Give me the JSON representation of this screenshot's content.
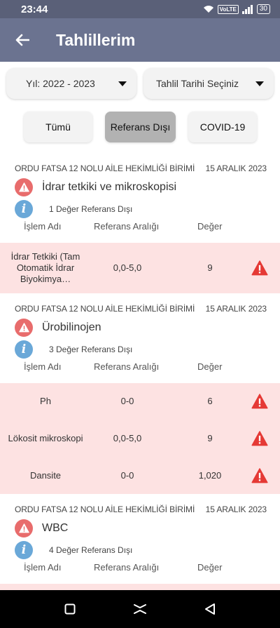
{
  "status_bar": {
    "time": "23:44",
    "network": "VoLTE",
    "battery": "30"
  },
  "app_bar": {
    "title": "Tahlillerim"
  },
  "filters": {
    "year": "Yıl: 2022 - 2023",
    "date": "Tahlil Tarihi Seçiniz"
  },
  "tabs": [
    {
      "label": "Tümü",
      "active": false
    },
    {
      "label": "Referans Dışı",
      "active": true
    },
    {
      "label": "COVID-19",
      "active": false
    }
  ],
  "column_headers": {
    "name": "İşlem Adı",
    "range": "Referans Aralığı",
    "value": "Değer"
  },
  "records": [
    {
      "institution": "ORDU FATSA 12 NOLU AİLE HEKİMLİĞİ BİRİMİ",
      "date": "15 ARALIK 2023",
      "title": "İdrar tetkiki ve mikroskopisi",
      "summary": "1 Değer Referans Dışı",
      "rows": [
        {
          "name": "İdrar Tetkiki (Tam Otomatik İdrar Biyokimya…",
          "range": "0,0-5,0",
          "value": "9"
        }
      ]
    },
    {
      "institution": "ORDU FATSA 12 NOLU AİLE HEKİMLİĞİ BİRİMİ",
      "date": "15 ARALIK 2023",
      "title": "Ürobilinojen",
      "summary": "3 Değer Referans Dışı",
      "rows": [
        {
          "name": "Ph",
          "range": "0-0",
          "value": "6"
        },
        {
          "name": "Lökosit mikroskopi",
          "range": "0,0-5,0",
          "value": "9"
        },
        {
          "name": "Dansite",
          "range": "0-0",
          "value": "1,020"
        }
      ]
    },
    {
      "institution": "ORDU FATSA 12 NOLU AİLE HEKİMLİĞİ BİRİMİ",
      "date": "15 ARALIK 2023",
      "title": "WBC",
      "summary": "4 Değer Referans Dışı",
      "rows": [
        {
          "name": "",
          "range": "",
          "value": ""
        }
      ]
    }
  ],
  "colors": {
    "status_bar": "#5a6078",
    "app_bar": "#6b7390",
    "warning": "#e53935",
    "warning_badge": "#e86c6c",
    "info_badge": "#6aa8d8",
    "row_bg": "#fde2e2",
    "active_tab": "#b2b2b2"
  },
  "icons": {
    "back": "arrow-left-icon",
    "warning": "warning-triangle-icon",
    "info": "info-icon",
    "nav_recent": "square-icon",
    "nav_home": "home-chevron-icon",
    "nav_back": "triangle-back-icon"
  }
}
